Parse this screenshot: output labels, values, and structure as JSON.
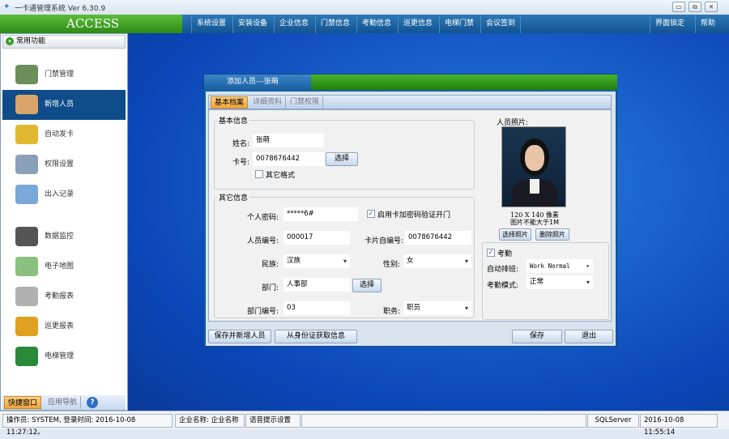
{
  "window": {
    "title": "一卡通管理系统  Ver 6.30.9",
    "controls": [
      "▭",
      "⧉",
      "✕"
    ]
  },
  "menu": {
    "brand": "ACCESS",
    "items": [
      "系统设置",
      "安装设备",
      "企业信息",
      "门禁信息",
      "考勤信息",
      "巡更信息",
      "电梯门禁",
      "会议签到"
    ],
    "right": [
      "界面锁定",
      "帮助"
    ]
  },
  "sidebar": {
    "header": "常用功能",
    "items": [
      {
        "label": "门禁管理",
        "icon": "door-access-icon",
        "color": "#6b8e5a"
      },
      {
        "label": "新增人员",
        "icon": "user-add-icon",
        "color": "#d9a36a",
        "selected": true
      },
      {
        "label": "自动发卡",
        "icon": "card-icon",
        "color": "#e0b830"
      },
      {
        "label": "权限设置",
        "icon": "permission-icon",
        "color": "#8aa0b8"
      },
      {
        "label": "出入记录",
        "icon": "search-record-icon",
        "color": "#7aa8d8"
      },
      {
        "label": "数据监控",
        "icon": "camera-icon",
        "color": "#555555"
      },
      {
        "label": "电子地图",
        "icon": "map-icon",
        "color": "#8cc080"
      },
      {
        "label": "考勤报表",
        "icon": "clock-icon",
        "color": "#b0b0b0"
      },
      {
        "label": "巡更报表",
        "icon": "patrol-icon",
        "color": "#e0a020"
      },
      {
        "label": "电梯管理",
        "icon": "elevator-icon",
        "color": "#2a8a3a"
      }
    ],
    "tabs": [
      "快捷窗口",
      "应用导航",
      "?"
    ]
  },
  "dialog": {
    "title": "添加人员---张萌",
    "tabs": [
      "基本档案",
      "详细资料",
      "门禁权限"
    ],
    "basic": {
      "group": "基本信息",
      "name_label": "姓名:",
      "name": "张萌",
      "card_label": "卡号:",
      "card": "0078676442",
      "select": "选择",
      "other_format": "其它格式",
      "other_format_checked": false
    },
    "other": {
      "group": "其它信息",
      "pwd_label": "个人密码:",
      "pwd": "*****6#",
      "card_pwd": "启用卡加密码验证开门",
      "card_pwd_checked": true,
      "emp_no_label": "人员编号:",
      "emp_no": "000017",
      "card_self_label": "卡片自编号:",
      "card_self": "0078676442",
      "nation_label": "民族:",
      "nation": "汉族",
      "gender_label": "性别:",
      "gender": "女",
      "dept_label": "部门:",
      "dept": "人事部",
      "dept_select": "选择",
      "dept_no_label": "部门编号:",
      "dept_no": "03",
      "position_label": "职务:",
      "position": "职员"
    },
    "photo": {
      "label": "人员照片:",
      "size": "120 X 140 像素",
      "limit": "图片不能大于1M",
      "select": "选择照片",
      "delete": "删除照片"
    },
    "attendance": {
      "label": "考勤",
      "checked": true,
      "shift_label": "自动排班:",
      "shift": "Work Normal",
      "mode_label": "考勤模式:",
      "mode": "正常"
    },
    "buttons": {
      "save_new": "保存并新增人员",
      "from_id": "从身份证获取信息",
      "save": "保存",
      "exit": "退出"
    }
  },
  "status": {
    "operator": "操作员: SYSTEM, 登录时间: 2016-10-08 11:27:12。",
    "company": "企业名称: 企业名称",
    "voice": "语音提示设置",
    "db": "SQLServer",
    "time": "2016-10-08 11:55:14"
  }
}
